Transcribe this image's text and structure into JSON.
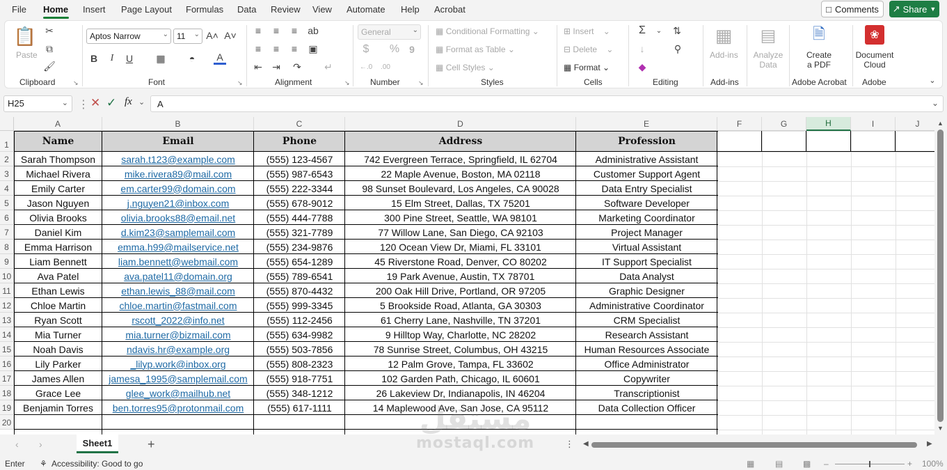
{
  "menu": {
    "items": [
      "File",
      "Home",
      "Insert",
      "Page Layout",
      "Formulas",
      "Data",
      "Review",
      "View",
      "Automate",
      "Help",
      "Acrobat"
    ],
    "active": "Home",
    "comments": "Comments",
    "share": "Share"
  },
  "ribbon": {
    "clipboard": {
      "label": "Clipboard",
      "paste": "Paste"
    },
    "font": {
      "label": "Font",
      "name": "Aptos Narrow",
      "size": "11",
      "bold": "B",
      "italic": "I",
      "underline": "U"
    },
    "alignment": {
      "label": "Alignment"
    },
    "number": {
      "label": "Number",
      "format": "General",
      "currency": "$",
      "percent": "%",
      "comma": "9"
    },
    "styles": {
      "label": "Styles",
      "conditional": "Conditional Formatting",
      "format_table": "Format as Table",
      "cell_styles": "Cell Styles"
    },
    "cells": {
      "label": "Cells",
      "insert": "Insert",
      "delete": "Delete",
      "format": "Format"
    },
    "editing": {
      "label": "Editing"
    },
    "addins": {
      "label": "Add-ins",
      "button": "Add-ins"
    },
    "analyze": {
      "label": "Analyze",
      "label2": "Data"
    },
    "acrobat": {
      "group": "Adobe Acrobat",
      "create": "Create",
      "create2": "a PDF"
    },
    "adobe": {
      "group": "Adobe",
      "doc": "Document",
      "doc2": "Cloud"
    }
  },
  "formula_bar": {
    "name_box": "H25",
    "fx": "fx",
    "value": "A"
  },
  "columns": [
    "A",
    "B",
    "C",
    "D",
    "E",
    "F",
    "G",
    "H",
    "I",
    "J"
  ],
  "selected_column": "H",
  "rows": [
    "1",
    "2",
    "3",
    "4",
    "5",
    "6",
    "7",
    "8",
    "9",
    "10",
    "11",
    "12",
    "13",
    "14",
    "15",
    "16",
    "17",
    "18",
    "19",
    "20"
  ],
  "table": {
    "headers": [
      "Name",
      "Email",
      "Phone",
      "Address",
      "Profession"
    ],
    "records": [
      [
        "Sarah Thompson",
        "sarah.t123@example.com",
        "(555) 123-4567",
        "742 Evergreen Terrace, Springfield, IL 62704",
        "Administrative Assistant"
      ],
      [
        "Michael Rivera",
        "mike.rivera89@mail.com",
        "(555) 987-6543",
        "22 Maple Avenue, Boston, MA 02118",
        "Customer Support Agent"
      ],
      [
        "Emily Carter",
        "em.carter99@domain.com",
        "(555) 222-3344",
        "98 Sunset Boulevard, Los Angeles, CA 90028",
        "Data Entry Specialist"
      ],
      [
        "Jason Nguyen",
        "j.nguyen21@inbox.com",
        "(555) 678-9012",
        "15 Elm Street, Dallas, TX 75201",
        "Software Developer"
      ],
      [
        "Olivia Brooks",
        "olivia.brooks88@email.net",
        "(555) 444-7788",
        "300 Pine Street, Seattle, WA 98101",
        "Marketing Coordinator"
      ],
      [
        "Daniel Kim",
        "d.kim23@samplemail.com",
        "(555) 321-7789",
        "77 Willow Lane, San Diego, CA 92103",
        "Project Manager"
      ],
      [
        "Emma Harrison",
        "emma.h99@mailservice.net",
        "(555) 234-9876",
        "120 Ocean View Dr, Miami, FL 33101",
        "Virtual Assistant"
      ],
      [
        "Liam Bennett",
        "liam.bennett@webmail.com",
        "(555) 654-1289",
        "45 Riverstone Road, Denver, CO 80202",
        "IT Support Specialist"
      ],
      [
        "Ava Patel",
        "ava.patel11@domain.org",
        "(555) 789-6541",
        "19 Park Avenue, Austin, TX 78701",
        "Data Analyst"
      ],
      [
        "Ethan Lewis",
        "ethan.lewis_88@mail.com",
        "(555) 870-4432",
        "200 Oak Hill Drive, Portland, OR 97205",
        "Graphic Designer"
      ],
      [
        "Chloe Martin",
        "chloe.martin@fastmail.com",
        "(555) 999-3345",
        "5 Brookside Road, Atlanta, GA 30303",
        "Administrative Coordinator"
      ],
      [
        "Ryan Scott",
        "rscott_2022@info.net",
        "(555) 112-2456",
        "61 Cherry Lane, Nashville, TN 37201",
        "CRM Specialist"
      ],
      [
        "Mia Turner",
        "mia.turner@bizmail.com",
        "(555) 634-9982",
        "9 Hilltop Way, Charlotte, NC 28202",
        "Research Assistant"
      ],
      [
        "Noah Davis",
        "ndavis.hr@example.org",
        "(555) 503-7856",
        "78 Sunrise Street, Columbus, OH 43215",
        "Human Resources Associate"
      ],
      [
        "Lily Parker",
        "_lilyp.work@inbox.org",
        "(555) 808-2323",
        "12 Palm Grove, Tampa, FL 33602",
        "Office Administrator"
      ],
      [
        "James Allen",
        "jamesa_1995@samplemail.com",
        "(555) 918-7751",
        "102 Garden Path, Chicago, IL 60601",
        "Copywriter"
      ],
      [
        "Grace Lee",
        "glee_work@mailhub.net",
        "(555) 348-1212",
        "26 Lakeview Dr, Indianapolis, IN 46204",
        "Transcriptionist"
      ],
      [
        "Benjamin Torres",
        "ben.torres95@protonmail.com",
        "(555) 617-1111",
        "14 Maplewood Ave, San Jose, CA 95112",
        "Data Collection Officer"
      ]
    ]
  },
  "sheets": {
    "active": "Sheet1",
    "add": "+"
  },
  "status": {
    "mode": "Enter",
    "accessibility": "Accessibility: Good to go",
    "zoom": "100%"
  },
  "watermark": {
    "arabic": "مستقل",
    "latin": "mostaql.com"
  },
  "colors": {
    "accent": "#217346",
    "share": "#1e7e44",
    "link": "#1f6aa5",
    "header_fill": "#d4d4d4",
    "acrobat_red": "#d32f2f"
  }
}
